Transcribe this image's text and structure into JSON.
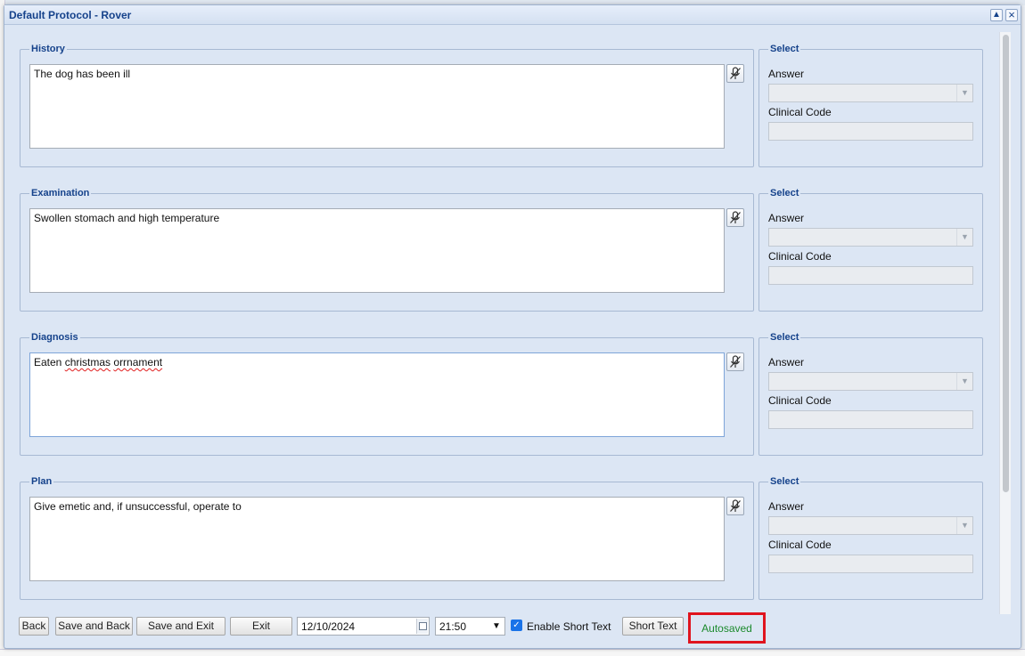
{
  "window": {
    "title": "Default Protocol - Rover",
    "collapse_icon": "chevron-up-icon",
    "close_icon": "close-icon"
  },
  "sections": [
    {
      "legend": "History",
      "text": "The dog has been ill",
      "select": {
        "legend": "Select",
        "answer_label": "Answer",
        "answer_value": "",
        "code_label": "Clinical Code",
        "code_value": ""
      }
    },
    {
      "legend": "Examination",
      "text": "Swollen stomach and high temperature",
      "select": {
        "legend": "Select",
        "answer_label": "Answer",
        "answer_value": "",
        "code_label": "Clinical Code",
        "code_value": ""
      }
    },
    {
      "legend": "Diagnosis",
      "text_parts": [
        "Eaten ",
        "christmas",
        " ",
        "orrnament"
      ],
      "select": {
        "legend": "Select",
        "answer_label": "Answer",
        "answer_value": "",
        "code_label": "Clinical Code",
        "code_value": ""
      }
    },
    {
      "legend": "Plan",
      "text": "Give emetic and, if unsuccessful, operate to",
      "select": {
        "legend": "Select",
        "answer_label": "Answer",
        "answer_value": "",
        "code_label": "Clinical Code",
        "code_value": ""
      }
    }
  ],
  "footer": {
    "back": "Back",
    "save_and_back": "Save and Back",
    "save_and_exit": "Save and Exit",
    "exit": "Exit",
    "date": "12/10/2024",
    "time": "21:50",
    "enable_short_text": "Enable Short Text",
    "enable_short_text_checked": true,
    "short_text": "Short Text",
    "autosaved": "Autosaved"
  },
  "colors": {
    "title_text": "#15428b",
    "window_bg": "#dce6f4",
    "autosaved_text": "#1b8a2c",
    "highlight_border": "#e0141e",
    "checkbox": "#1a73e8"
  }
}
